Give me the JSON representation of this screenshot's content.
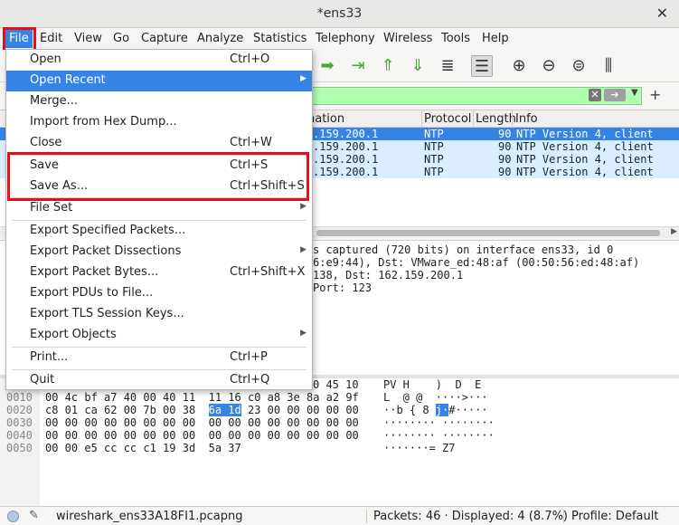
{
  "window": {
    "title": "*ens33"
  },
  "menubar": [
    "File",
    "Edit",
    "View",
    "Go",
    "Capture",
    "Analyze",
    "Statistics",
    "Telephony",
    "Wireless",
    "Tools",
    "Help"
  ],
  "file_menu": {
    "open": {
      "label": "Open",
      "shortcut": "Ctrl+O"
    },
    "open_recent": {
      "label": "Open Recent"
    },
    "merge": {
      "label": "Merge..."
    },
    "import_hex": {
      "label": "Import from Hex Dump..."
    },
    "close": {
      "label": "Close",
      "shortcut": "Ctrl+W"
    },
    "save": {
      "label": "Save",
      "shortcut": "Ctrl+S"
    },
    "save_as": {
      "label": "Save As...",
      "shortcut": "Ctrl+Shift+S"
    },
    "file_set": {
      "label": "File Set"
    },
    "export_specified": {
      "label": "Export Specified Packets..."
    },
    "export_dissections": {
      "label": "Export Packet Dissections"
    },
    "export_bytes": {
      "label": "Export Packet Bytes...",
      "shortcut": "Ctrl+Shift+X"
    },
    "export_pdus": {
      "label": "Export PDUs to File..."
    },
    "export_tls": {
      "label": "Export TLS Session Keys..."
    },
    "export_objects": {
      "label": "Export Objects"
    },
    "print": {
      "label": "Print...",
      "shortcut": "Ctrl+P"
    },
    "quit": {
      "label": "Quit",
      "shortcut": "Ctrl+Q"
    }
  },
  "packet_list": {
    "columns": [
      "nation",
      "Protocol",
      "Length",
      "Info"
    ],
    "rows": [
      {
        "dst": ".159.200.1",
        "proto": "NTP",
        "len": "90",
        "info": "NTP Version 4, client"
      },
      {
        "dst": ".159.200.1",
        "proto": "NTP",
        "len": "90",
        "info": "NTP Version 4, client"
      },
      {
        "dst": ".159.200.1",
        "proto": "NTP",
        "len": "90",
        "info": "NTP Version 4, client"
      },
      {
        "dst": ".159.200.1",
        "proto": "NTP",
        "len": "90",
        "info": "NTP Version 4, client"
      }
    ]
  },
  "details": [
    "s captured (720 bits) on interface ens33, id 0",
    "6:e9:44), Dst: VMware_ed:48:af (00:50:56:ed:48:af)",
    "138, Dst: 162.159.200.1",
    "Port: 123"
  ],
  "bytes": {
    "row0_hex_tail": "0 45 10",
    "row0_ascii": "PV H    )  D  E",
    "offsets": [
      "0010",
      "0020",
      "0030",
      "0040",
      "0050"
    ],
    "hex_rows": [
      {
        "a": "00 4c bf a7 40 00 40 11  11 16 c0 a8 3e 8a a2 9f",
        "b": "",
        "c": ""
      },
      {
        "a": "c8 01 ca 62 00 7b 00 38  ",
        "b": "6a 1d",
        "c": " 23 00 00 00 00 00"
      },
      {
        "a": "00 00 00 00 00 00 00 00  00 00 00 00 00 00 00 00",
        "b": "",
        "c": ""
      },
      {
        "a": "00 00 00 00 00 00 00 00  00 00 00 00 00 00 00 00",
        "b": "",
        "c": ""
      },
      {
        "a": "00 00 e5 cc cc c1 19 3d  5a 37",
        "b": "",
        "c": ""
      }
    ],
    "ascii_rows": [
      {
        "a": "L  @ @  ····>···",
        "b": "",
        "c": ""
      },
      {
        "a": "··b { 8 ",
        "b": "j·",
        "c": "#·····"
      },
      {
        "a": "········ ········",
        "b": "",
        "c": ""
      },
      {
        "a": "········ ········",
        "b": "",
        "c": ""
      },
      {
        "a": "·······= Z7",
        "b": "",
        "c": ""
      }
    ]
  },
  "statusbar": {
    "file": "wireshark_ens33A18FI1.pcapng",
    "packets": "Packets: 46 · Displayed: 4 (8.7%)",
    "profile": "Profile: Default"
  },
  "colors": {
    "accent": "#3584e4",
    "filter_ok": "#afffaf",
    "highlight_box": "#e0101c"
  }
}
